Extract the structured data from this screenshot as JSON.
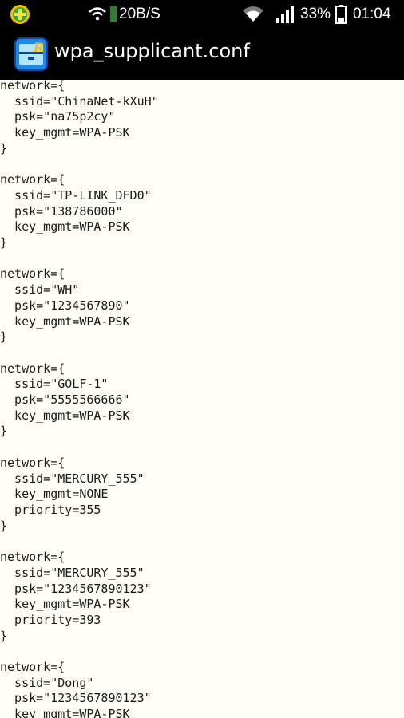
{
  "status_bar": {
    "notification_icon": "app-notification-icon",
    "wifi_hotspot_icon": "wifi-icon",
    "data_rate": "20B/S",
    "wifi_icon": "wifi-icon",
    "signal_icon": "signal-icon",
    "battery_percent": "33%",
    "battery_icon": "battery-icon",
    "time": "01:04"
  },
  "title_bar": {
    "app_icon": "root-explorer-icon",
    "title": "wpa_supplicant.conf"
  },
  "file_content": "network={\n  ssid=\"ChinaNet-kXuH\"\n  psk=\"na75p2cy\"\n  key_mgmt=WPA-PSK\n}\n\nnetwork={\n  ssid=\"TP-LINK_DFD0\"\n  psk=\"138786000\"\n  key_mgmt=WPA-PSK\n}\n\nnetwork={\n  ssid=\"WH\"\n  psk=\"1234567890\"\n  key_mgmt=WPA-PSK\n}\n\nnetwork={\n  ssid=\"GOLF-1\"\n  psk=\"5555566666\"\n  key_mgmt=WPA-PSK\n}\n\nnetwork={\n  ssid=\"MERCURY_555\"\n  key_mgmt=NONE\n  priority=355\n}\n\nnetwork={\n  ssid=\"MERCURY_555\"\n  psk=\"1234567890123\"\n  key_mgmt=WPA-PSK\n  priority=393\n}\n\nnetwork={\n  ssid=\"Dong\"\n  psk=\"1234567890123\"\n  key_mgmt=WPA-PSK"
}
